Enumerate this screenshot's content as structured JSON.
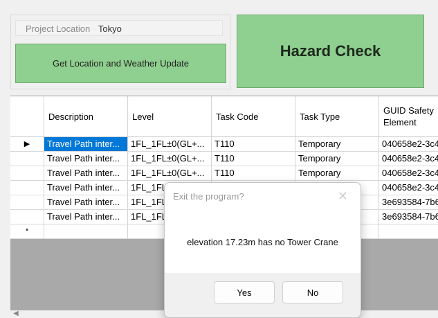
{
  "project": {
    "location_label": "Project Location",
    "location_value": "Tokyo"
  },
  "buttons": {
    "weather": "Get Location and Weather Update",
    "hazard": "Hazard Check"
  },
  "grid": {
    "columns": [
      "Description",
      "Level",
      "Task Code",
      "Task Type",
      "GUID Safety Element"
    ],
    "rows": [
      [
        "Travel Path inter...",
        "1FL_1FL±0(GL+...",
        "T110",
        "Temporary",
        "040658e2-3c4"
      ],
      [
        "Travel Path inter...",
        "1FL_1FL±0(GL+...",
        "T110",
        "Temporary",
        "040658e2-3c4"
      ],
      [
        "Travel Path inter...",
        "1FL_1FL±0(GL+...",
        "T110",
        "Temporary",
        "040658e2-3c4"
      ],
      [
        "Travel Path inter...",
        "1FL_1FL",
        "",
        "",
        "040658e2-3c4"
      ],
      [
        "Travel Path inter...",
        "1FL_1FL",
        "",
        "",
        "3e693584-7b6"
      ],
      [
        "Travel Path inter...",
        "1FL_1FL",
        "",
        "",
        "3e693584-7b6"
      ]
    ],
    "current_row_marker": "▶",
    "new_row_marker": "*"
  },
  "dialog": {
    "title": "Exit the program?",
    "message": "elevation 17.23m has no Tower Crane",
    "yes": "Yes",
    "no": "No",
    "close_glyph": "✕"
  },
  "scroll": {
    "left_glyph": "◀"
  }
}
